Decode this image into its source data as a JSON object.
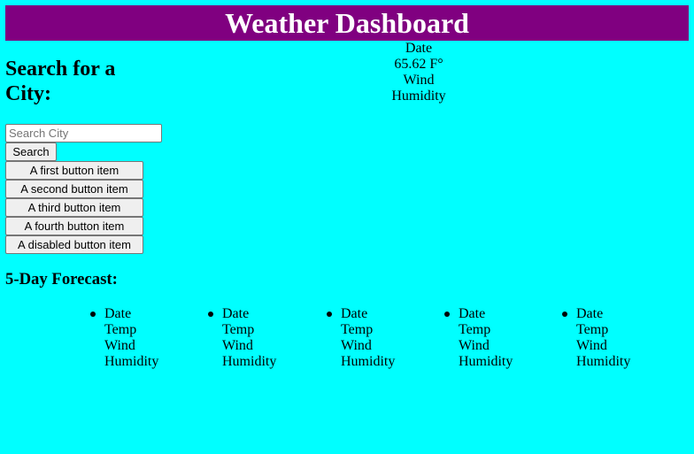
{
  "header": {
    "title": "Weather Dashboard"
  },
  "search": {
    "heading": "Search for a City:",
    "placeholder": "Search City",
    "value": "",
    "button_label": "Search"
  },
  "city_buttons": [
    {
      "label": "A first button item",
      "disabled": false
    },
    {
      "label": "A second button item",
      "disabled": false
    },
    {
      "label": "A third button item",
      "disabled": false
    },
    {
      "label": "A fourth button item",
      "disabled": false
    },
    {
      "label": "A disabled button item",
      "disabled": true
    }
  ],
  "current": {
    "date": "Date",
    "temp": "65.62 F°",
    "wind": "Wind",
    "humidity": "Humidity"
  },
  "forecast": {
    "heading": "5-Day Forecast:",
    "days": [
      {
        "date": "Date",
        "temp": "Temp",
        "wind": "Wind",
        "humidity": "Humidity"
      },
      {
        "date": "Date",
        "temp": "Temp",
        "wind": "Wind",
        "humidity": "Humidity"
      },
      {
        "date": "Date",
        "temp": "Temp",
        "wind": "Wind",
        "humidity": "Humidity"
      },
      {
        "date": "Date",
        "temp": "Temp",
        "wind": "Wind",
        "humidity": "Humidity"
      },
      {
        "date": "Date",
        "temp": "Temp",
        "wind": "Wind",
        "humidity": "Humidity"
      }
    ]
  },
  "colors": {
    "background": "#00FFFF",
    "header_background": "#800080",
    "header_text": "#FFFFFF"
  }
}
